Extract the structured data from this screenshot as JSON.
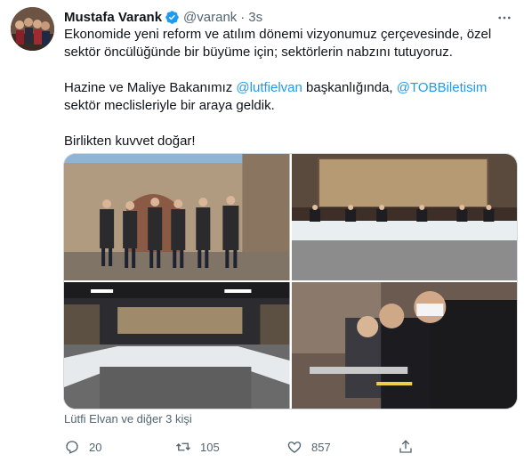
{
  "tweet": {
    "author_name": "Mustafa Varank",
    "handle": "@varank",
    "separator": "·",
    "time": "3s",
    "paragraph1": "Ekonomide yeni reform ve atılım dönemi vizyonumuz çerçevesinde, özel sektör öncülüğünde bir büyüme için; sektörlerin nabzını tutuyoruz.",
    "p2_before": "Hazine ve Maliye Bakanımız ",
    "p2_mention1": "@lutfielvan",
    "p2_middle": " başkanlığında, ",
    "p2_mention2": "@TOBBiletisim",
    "p2_after": " sektör meclisleriyle bir araya geldik.",
    "paragraph3": "Birlikten kuvvet doğar!",
    "tagged": "Lütfi Elvan ve diğer 3 kişi"
  },
  "actions": {
    "reply_count": "20",
    "retweet_count": "105",
    "like_count": "857"
  },
  "colors": {
    "link": "#1d9bf0",
    "secondary_text": "#536471",
    "primary_text": "#0f1419",
    "verified": "#1d9bf0"
  },
  "icons": [
    "verified-badge-icon",
    "more-icon",
    "person-tag-icon",
    "reply-icon",
    "retweet-icon",
    "like-icon",
    "share-icon"
  ]
}
